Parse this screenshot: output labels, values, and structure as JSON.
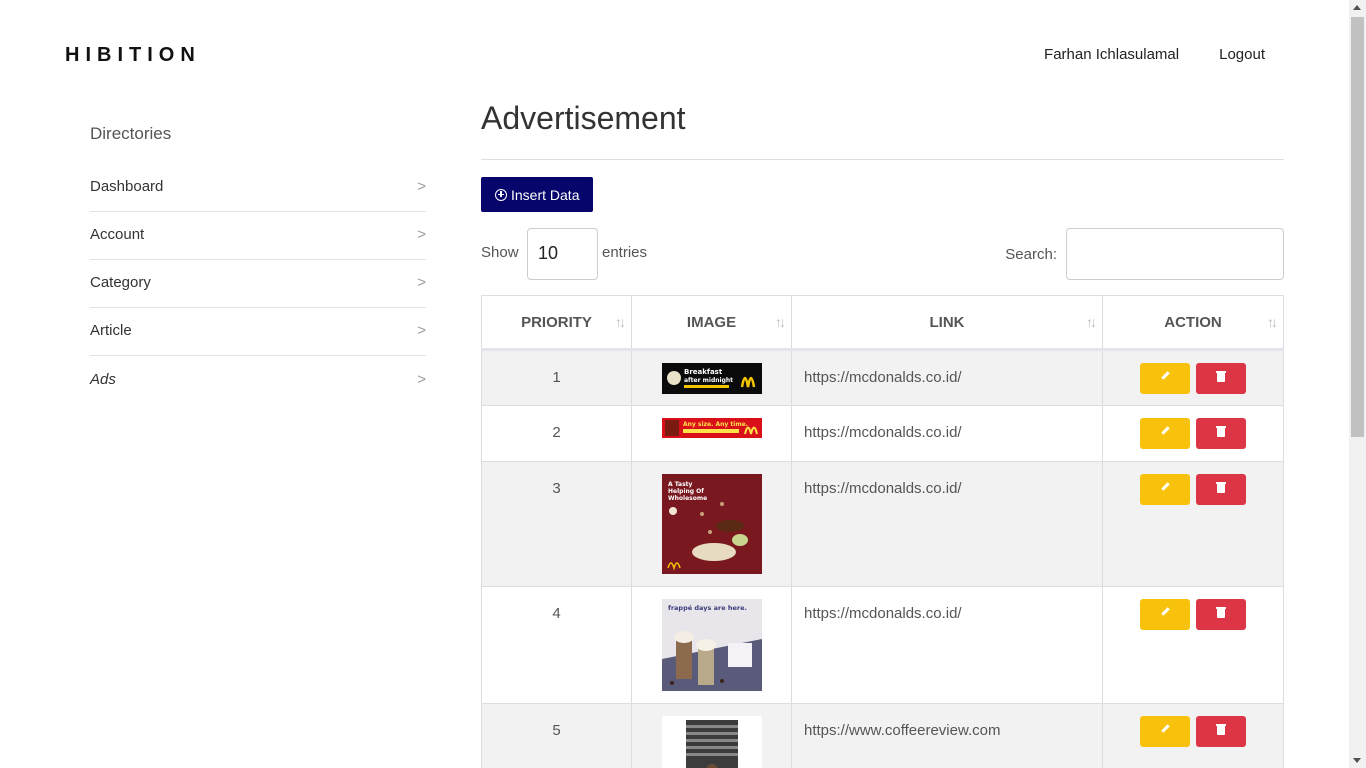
{
  "header": {
    "brand": "HIBITION",
    "user_name": "Farhan Ichlasulamal",
    "logout_label": "Logout"
  },
  "sidebar": {
    "title": "Directories",
    "items": [
      {
        "label": "Dashboard",
        "chevron": ">"
      },
      {
        "label": "Account",
        "chevron": ">"
      },
      {
        "label": "Category",
        "chevron": ">"
      },
      {
        "label": "Article",
        "chevron": ">"
      },
      {
        "label": "Ads",
        "chevron": ">"
      }
    ]
  },
  "main": {
    "title": "Advertisement",
    "insert_label": "Insert Data",
    "show_label": "Show",
    "entries_value": "10",
    "entries_label": "entries",
    "search_label": "Search:",
    "search_value": ""
  },
  "table": {
    "columns": [
      "PRIORITY",
      "IMAGE",
      "LINK",
      "ACTION"
    ],
    "sort_glyph": "↑↓",
    "rows": [
      {
        "priority": "1",
        "link": "https://mcdonalds.co.id/",
        "image": "mcdonalds-breakfast-banner"
      },
      {
        "priority": "2",
        "link": "https://mcdonalds.co.id/",
        "image": "mcdonalds-any-size-banner"
      },
      {
        "priority": "3",
        "link": "https://mcdonalds.co.id/",
        "image": "mcdonalds-oatmeal-poster"
      },
      {
        "priority": "4",
        "link": "https://mcdonalds.co.id/",
        "image": "mcdonalds-frappe-poster"
      },
      {
        "priority": "5",
        "link": "https://www.coffeereview.com",
        "image": "coffee-review-ad"
      }
    ]
  },
  "colors": {
    "insert_button": "#05056b",
    "edit_button": "#f8c20c",
    "delete_button": "#dc3545"
  },
  "image_text": {
    "breakfast_line1": "Breakfast",
    "breakfast_line2": "after midnight",
    "anysize": "Any size. Any time.",
    "oatmeal_title": "A Tasty Helping Of Wholesome",
    "frappe_title": "frappé days are here."
  }
}
